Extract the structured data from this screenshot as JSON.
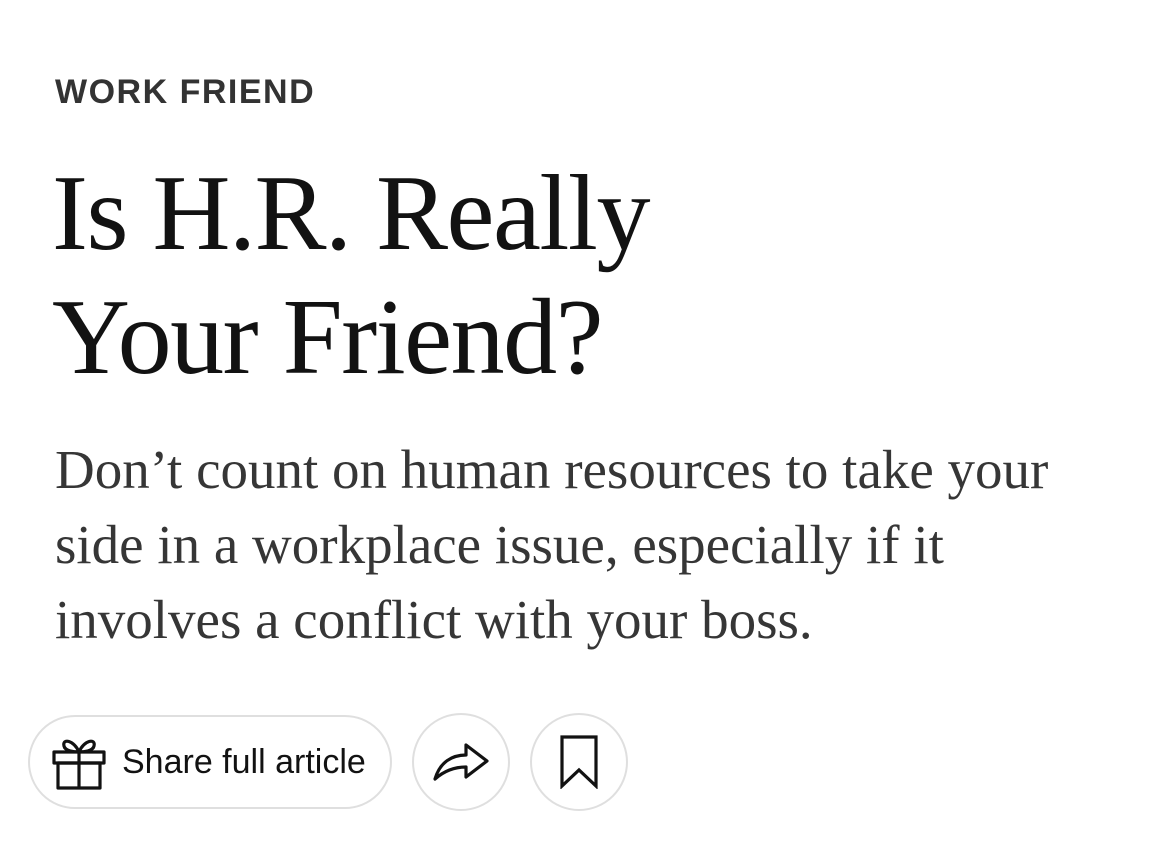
{
  "article": {
    "kicker": "WORK FRIEND",
    "headline_line1": "Is H.R. Really",
    "headline_line2": "Your Friend?",
    "summary": "Don’t count on human resources to take your side in a workplace issue, especially if it involves a conflict with your boss."
  },
  "actions": {
    "share_full_label": "Share full article",
    "gift_icon": "gift-icon",
    "share_icon": "share-arrow-icon",
    "bookmark_icon": "bookmark-icon"
  },
  "colors": {
    "text": "#121212",
    "summary_text": "#363636",
    "button_border": "#dfdfdf",
    "background": "#ffffff"
  }
}
